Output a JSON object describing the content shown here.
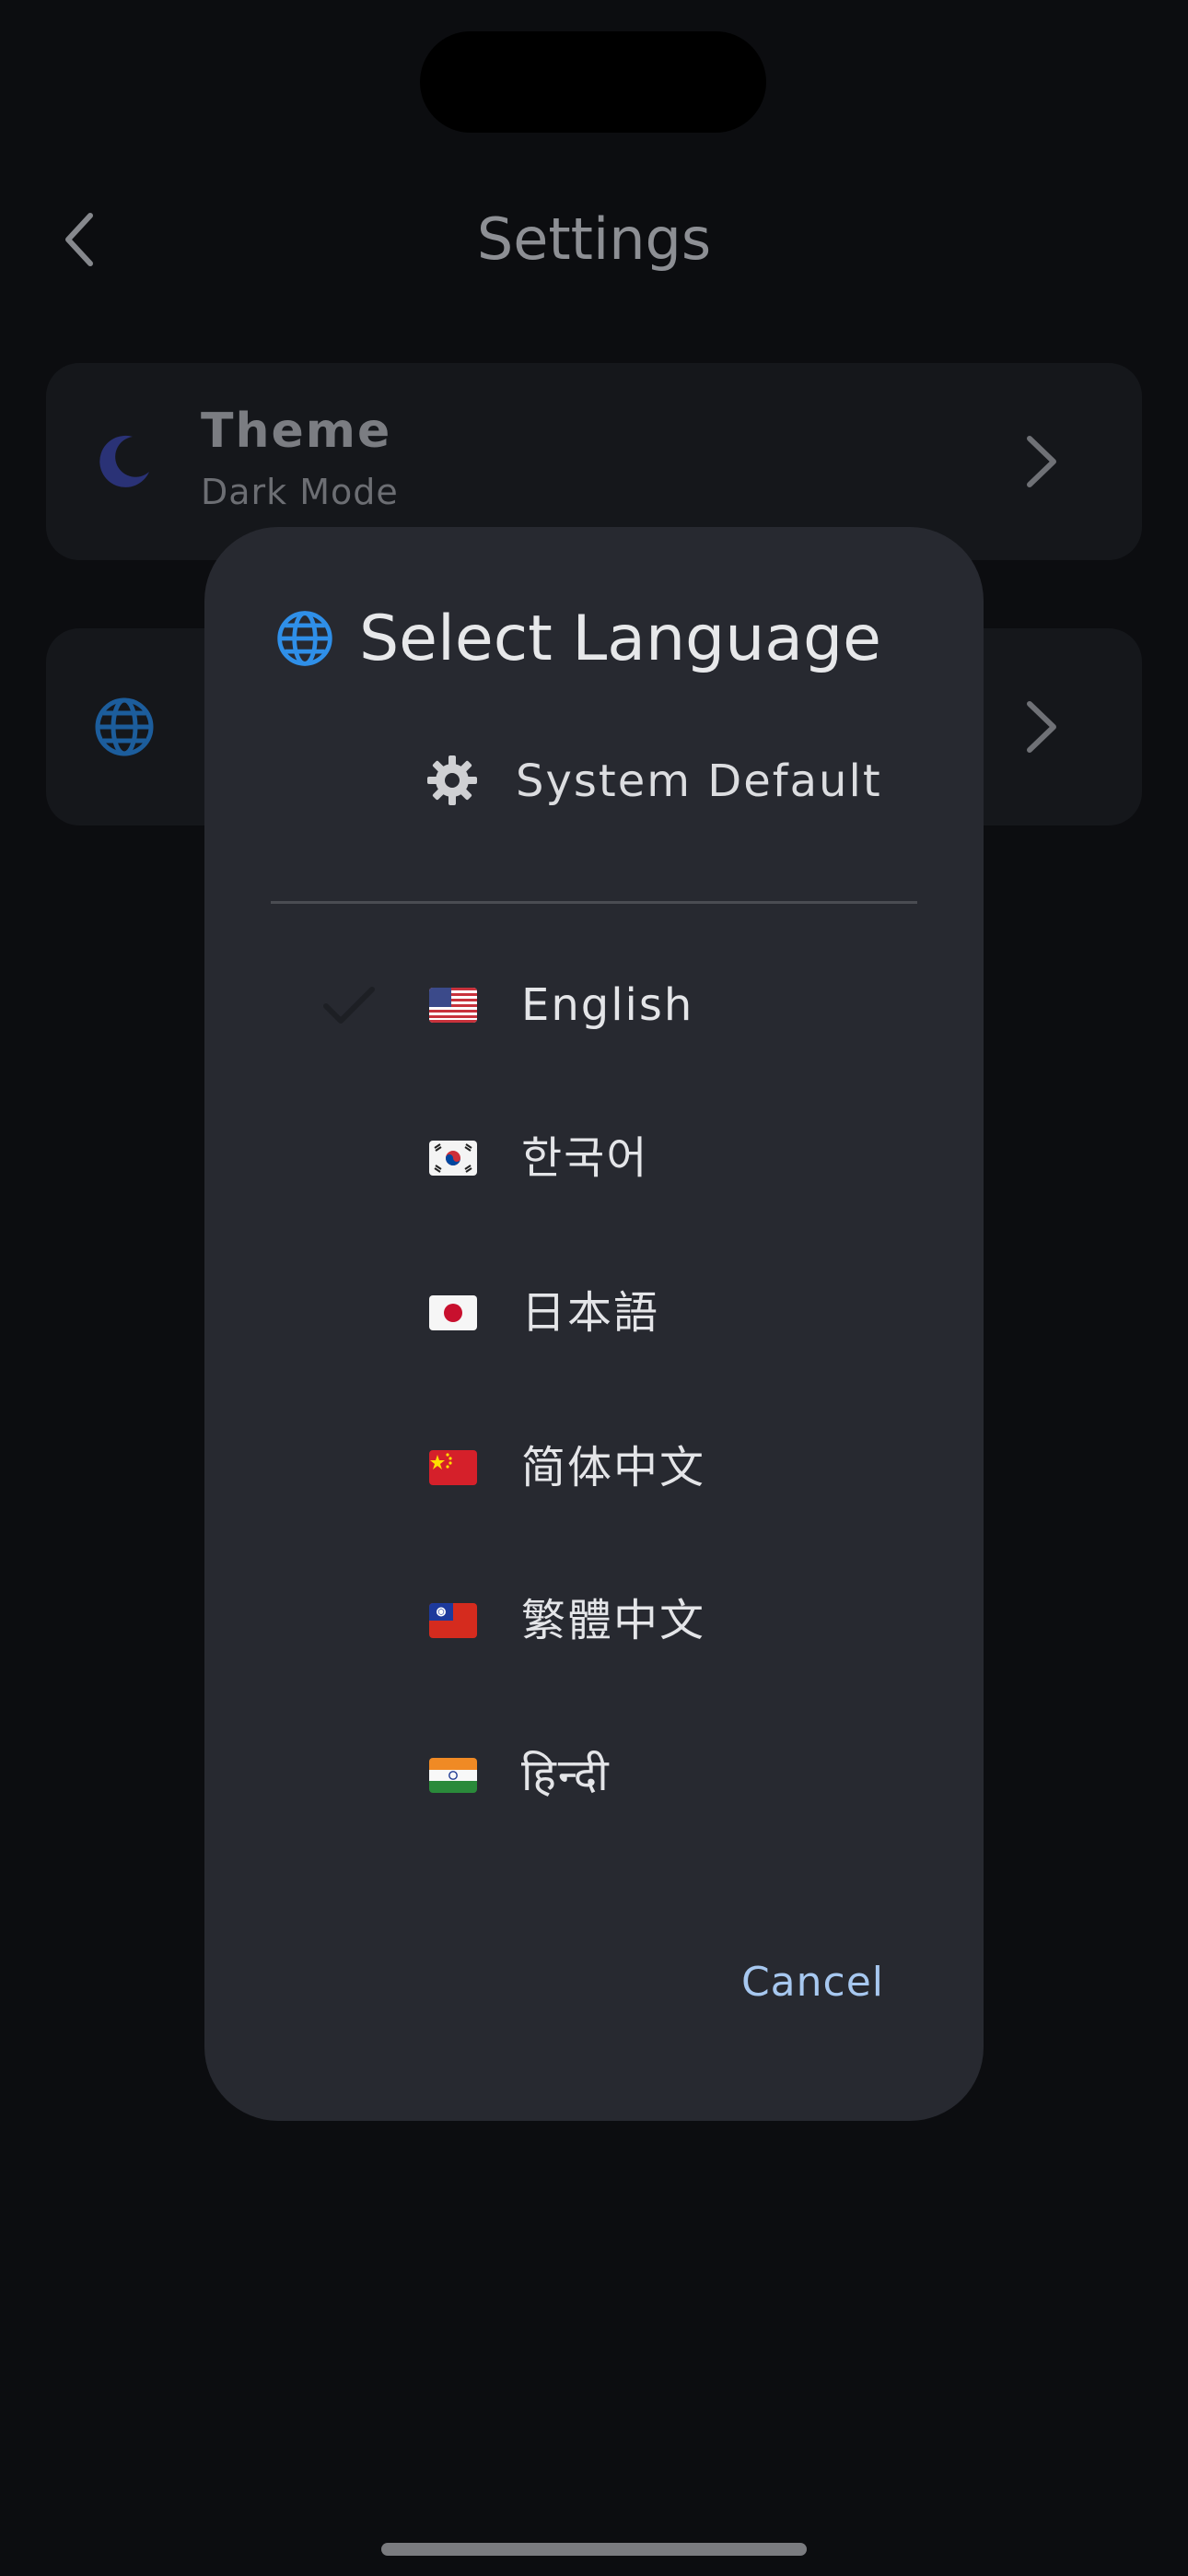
{
  "header": {
    "title": "Settings"
  },
  "cards": {
    "theme": {
      "title": "Theme",
      "subtitle": "Dark Mode",
      "icon": "moon-icon"
    },
    "language": {
      "icon": "globe-icon"
    }
  },
  "dialog": {
    "title": "Select Language",
    "title_icon": "globe-icon",
    "system_default": {
      "label": "System Default",
      "icon": "gear-icon"
    },
    "languages": [
      {
        "label": "English",
        "flag": "us-flag-icon",
        "selected": true
      },
      {
        "label": "한국어",
        "flag": "kr-flag-icon",
        "selected": false
      },
      {
        "label": "日本語",
        "flag": "jp-flag-icon",
        "selected": false
      },
      {
        "label": "简体中文",
        "flag": "cn-flag-icon",
        "selected": false
      },
      {
        "label": "繁體中文",
        "flag": "tw-flag-icon",
        "selected": false
      },
      {
        "label": "हिन्दी",
        "flag": "in-flag-icon",
        "selected": false
      }
    ],
    "cancel_label": "Cancel"
  },
  "colors": {
    "background": "#0c0d10",
    "dialog_bg": "#272930",
    "accent_blue": "#2f8fe8",
    "cancel_text": "#a7c8f0"
  }
}
